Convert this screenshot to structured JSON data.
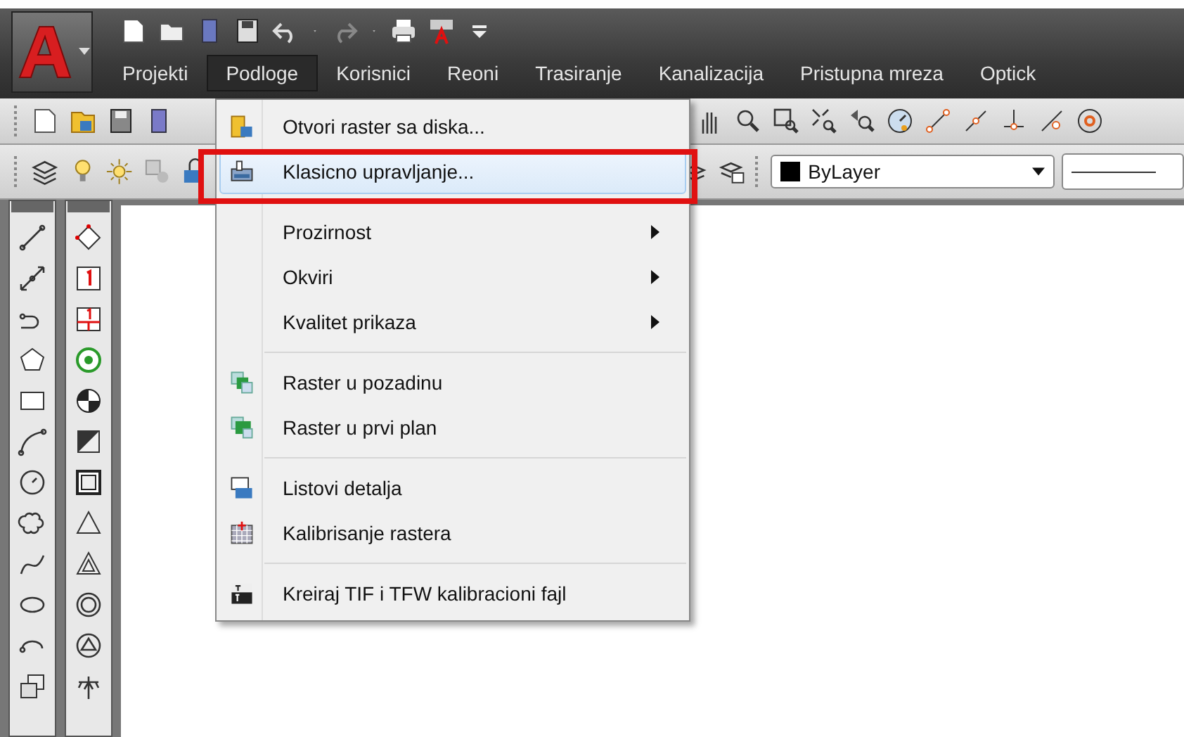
{
  "menu_bar": [
    {
      "label": "Projekti",
      "selected": false
    },
    {
      "label": "Podloge",
      "selected": true
    },
    {
      "label": "Korisnici",
      "selected": false
    },
    {
      "label": "Reoni",
      "selected": false
    },
    {
      "label": "Trasiranje",
      "selected": false
    },
    {
      "label": "Kanalizacija",
      "selected": false
    },
    {
      "label": "Pristupna mreza",
      "selected": false
    },
    {
      "label": "Optick",
      "selected": false
    }
  ],
  "color_dropdown": {
    "value": "ByLayer",
    "color": "#000000"
  },
  "dropdown_menu": [
    {
      "kind": "item",
      "label": "Otvori raster sa diska...",
      "has_submenu": false,
      "selected": false,
      "framed": false
    },
    {
      "kind": "item",
      "label": "Klasicno upravljanje...",
      "has_submenu": false,
      "selected": true,
      "framed": true
    },
    {
      "kind": "separator"
    },
    {
      "kind": "item",
      "label": "Prozirnost",
      "has_submenu": true,
      "selected": false,
      "framed": false
    },
    {
      "kind": "item",
      "label": "Okviri",
      "has_submenu": true,
      "selected": false,
      "framed": false
    },
    {
      "kind": "item",
      "label": "Kvalitet prikaza",
      "has_submenu": true,
      "selected": false,
      "framed": false
    },
    {
      "kind": "separator"
    },
    {
      "kind": "item",
      "label": "Raster u pozadinu",
      "has_submenu": false,
      "selected": false,
      "framed": false
    },
    {
      "kind": "item",
      "label": "Raster u prvi plan",
      "has_submenu": false,
      "selected": false,
      "framed": false
    },
    {
      "kind": "separator"
    },
    {
      "kind": "item",
      "label": "Listovi detalja",
      "has_submenu": false,
      "selected": false,
      "framed": false
    },
    {
      "kind": "item",
      "label": "Kalibrisanje rastera",
      "has_submenu": false,
      "selected": false,
      "framed": false
    },
    {
      "kind": "separator"
    },
    {
      "kind": "item",
      "label": "Kreiraj TIF i TFW kalibracioni fajl",
      "has_submenu": false,
      "selected": false,
      "framed": false
    }
  ]
}
